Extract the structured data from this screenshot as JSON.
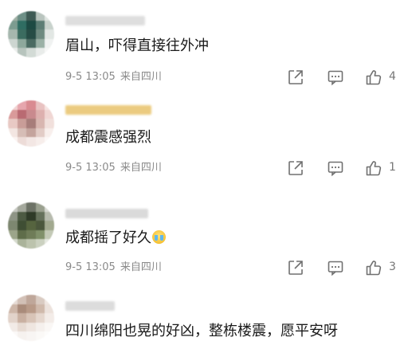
{
  "comments": [
    {
      "text": "眉山，吓得直接往外冲",
      "date": "9-5 13:05",
      "location": "来自四川",
      "likes": "4",
      "avatar_colors": [
        "#9fb0a5",
        "#6d8f86",
        "#3e5a54",
        "#b9c4be",
        "#dfe5e1",
        "#7c9c90",
        "#2f6d62",
        "#1d4a43",
        "#5c7d74",
        "#c8d2cc",
        "#a6b7ae",
        "#3b6c60",
        "#264c45",
        "#6e8a80",
        "#e2e7e4",
        "#cdd6d1",
        "#8ea89c",
        "#4b6b62",
        "#9bb1a6",
        "#f0f2f1",
        "#ebeeec",
        "#b7c4bd",
        "#d3dbd6",
        "#e9ecea",
        "#f6f7f6"
      ],
      "username_color": "#d9d9d9"
    },
    {
      "text": "成都震感强烈",
      "date": "9-5 13:05",
      "location": "来自四川",
      "likes": "1",
      "avatar_colors": [
        "#f1d2d2",
        "#e6a6ad",
        "#d98b91",
        "#e8c2c1",
        "#f6e4e2",
        "#d99a9a",
        "#b96a72",
        "#c98a8e",
        "#ddb0ae",
        "#f0d6d3",
        "#e8c9c4",
        "#c99d98",
        "#a77d7a",
        "#d8b6b0",
        "#f1e0dc",
        "#f3e6e2",
        "#d6bdb6",
        "#c4a49d",
        "#e2ccc6",
        "#f8efec",
        "#fbf4f2",
        "#eddcd8",
        "#f3e7e4",
        "#f7eeeb",
        "#fcf8f7"
      ],
      "username_color": "#e8c36a"
    },
    {
      "text": "成都摇了好久",
      "date": "9-5 13:05",
      "location": "来自四川",
      "likes": "3",
      "avatar_colors": [
        "#c7c9c2",
        "#a4a89c",
        "#6d7266",
        "#9aa08f",
        "#d7d9d2",
        "#8e9485",
        "#4d5a43",
        "#2f3a28",
        "#65705b",
        "#b7bbae",
        "#7d8770",
        "#3f4e34",
        "#56643f",
        "#4b573c",
        "#a2a98f",
        "#9ca58a",
        "#5f6d4a",
        "#6f7c58",
        "#80906a",
        "#c3c9b6",
        "#d5dacd",
        "#aab39a",
        "#bcc3ad",
        "#cbd1c0",
        "#e6e9e1"
      ],
      "username_color": "#d4d4d4"
    },
    {
      "text": "四川绵阳也晃的好凶，整栋楼震，愿平安呀",
      "avatar_colors": [
        "#e7dcd6",
        "#d2c0b6",
        "#bfa79a",
        "#d9cbc2",
        "#f0e8e3",
        "#cdb6a8",
        "#a98b7a",
        "#b89a88",
        "#cfb9ab",
        "#ece2dc",
        "#e2d3ca",
        "#c9b0a1",
        "#d8c4b7",
        "#e5d7ce",
        "#f3ece8",
        "#f2ebe7",
        "#e7dbd3",
        "#efe6e0",
        "#f5f0ed",
        "#faf7f5",
        "#fbf9f8",
        "#f6f2ef",
        "#f8f5f3",
        "#fbf9f7",
        "#fdfcfb"
      ],
      "username_color": "#d6d6d6"
    }
  ],
  "icons": {
    "share": "share-icon",
    "comment": "comment-icon",
    "like": "thumbs-up-icon",
    "emoji": "crying-face-emoji"
  }
}
